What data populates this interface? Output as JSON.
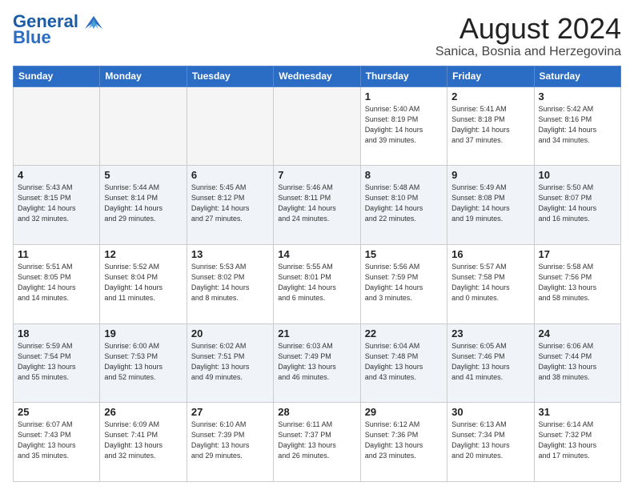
{
  "logo": {
    "line1": "General",
    "line2": "Blue"
  },
  "title": "August 2024",
  "subtitle": "Sanica, Bosnia and Herzegovina",
  "weekdays": [
    "Sunday",
    "Monday",
    "Tuesday",
    "Wednesday",
    "Thursday",
    "Friday",
    "Saturday"
  ],
  "weeks": [
    [
      {
        "day": "",
        "info": ""
      },
      {
        "day": "",
        "info": ""
      },
      {
        "day": "",
        "info": ""
      },
      {
        "day": "",
        "info": ""
      },
      {
        "day": "1",
        "info": "Sunrise: 5:40 AM\nSunset: 8:19 PM\nDaylight: 14 hours\nand 39 minutes."
      },
      {
        "day": "2",
        "info": "Sunrise: 5:41 AM\nSunset: 8:18 PM\nDaylight: 14 hours\nand 37 minutes."
      },
      {
        "day": "3",
        "info": "Sunrise: 5:42 AM\nSunset: 8:16 PM\nDaylight: 14 hours\nand 34 minutes."
      }
    ],
    [
      {
        "day": "4",
        "info": "Sunrise: 5:43 AM\nSunset: 8:15 PM\nDaylight: 14 hours\nand 32 minutes."
      },
      {
        "day": "5",
        "info": "Sunrise: 5:44 AM\nSunset: 8:14 PM\nDaylight: 14 hours\nand 29 minutes."
      },
      {
        "day": "6",
        "info": "Sunrise: 5:45 AM\nSunset: 8:12 PM\nDaylight: 14 hours\nand 27 minutes."
      },
      {
        "day": "7",
        "info": "Sunrise: 5:46 AM\nSunset: 8:11 PM\nDaylight: 14 hours\nand 24 minutes."
      },
      {
        "day": "8",
        "info": "Sunrise: 5:48 AM\nSunset: 8:10 PM\nDaylight: 14 hours\nand 22 minutes."
      },
      {
        "day": "9",
        "info": "Sunrise: 5:49 AM\nSunset: 8:08 PM\nDaylight: 14 hours\nand 19 minutes."
      },
      {
        "day": "10",
        "info": "Sunrise: 5:50 AM\nSunset: 8:07 PM\nDaylight: 14 hours\nand 16 minutes."
      }
    ],
    [
      {
        "day": "11",
        "info": "Sunrise: 5:51 AM\nSunset: 8:05 PM\nDaylight: 14 hours\nand 14 minutes."
      },
      {
        "day": "12",
        "info": "Sunrise: 5:52 AM\nSunset: 8:04 PM\nDaylight: 14 hours\nand 11 minutes."
      },
      {
        "day": "13",
        "info": "Sunrise: 5:53 AM\nSunset: 8:02 PM\nDaylight: 14 hours\nand 8 minutes."
      },
      {
        "day": "14",
        "info": "Sunrise: 5:55 AM\nSunset: 8:01 PM\nDaylight: 14 hours\nand 6 minutes."
      },
      {
        "day": "15",
        "info": "Sunrise: 5:56 AM\nSunset: 7:59 PM\nDaylight: 14 hours\nand 3 minutes."
      },
      {
        "day": "16",
        "info": "Sunrise: 5:57 AM\nSunset: 7:58 PM\nDaylight: 14 hours\nand 0 minutes."
      },
      {
        "day": "17",
        "info": "Sunrise: 5:58 AM\nSunset: 7:56 PM\nDaylight: 13 hours\nand 58 minutes."
      }
    ],
    [
      {
        "day": "18",
        "info": "Sunrise: 5:59 AM\nSunset: 7:54 PM\nDaylight: 13 hours\nand 55 minutes."
      },
      {
        "day": "19",
        "info": "Sunrise: 6:00 AM\nSunset: 7:53 PM\nDaylight: 13 hours\nand 52 minutes."
      },
      {
        "day": "20",
        "info": "Sunrise: 6:02 AM\nSunset: 7:51 PM\nDaylight: 13 hours\nand 49 minutes."
      },
      {
        "day": "21",
        "info": "Sunrise: 6:03 AM\nSunset: 7:49 PM\nDaylight: 13 hours\nand 46 minutes."
      },
      {
        "day": "22",
        "info": "Sunrise: 6:04 AM\nSunset: 7:48 PM\nDaylight: 13 hours\nand 43 minutes."
      },
      {
        "day": "23",
        "info": "Sunrise: 6:05 AM\nSunset: 7:46 PM\nDaylight: 13 hours\nand 41 minutes."
      },
      {
        "day": "24",
        "info": "Sunrise: 6:06 AM\nSunset: 7:44 PM\nDaylight: 13 hours\nand 38 minutes."
      }
    ],
    [
      {
        "day": "25",
        "info": "Sunrise: 6:07 AM\nSunset: 7:43 PM\nDaylight: 13 hours\nand 35 minutes."
      },
      {
        "day": "26",
        "info": "Sunrise: 6:09 AM\nSunset: 7:41 PM\nDaylight: 13 hours\nand 32 minutes."
      },
      {
        "day": "27",
        "info": "Sunrise: 6:10 AM\nSunset: 7:39 PM\nDaylight: 13 hours\nand 29 minutes."
      },
      {
        "day": "28",
        "info": "Sunrise: 6:11 AM\nSunset: 7:37 PM\nDaylight: 13 hours\nand 26 minutes."
      },
      {
        "day": "29",
        "info": "Sunrise: 6:12 AM\nSunset: 7:36 PM\nDaylight: 13 hours\nand 23 minutes."
      },
      {
        "day": "30",
        "info": "Sunrise: 6:13 AM\nSunset: 7:34 PM\nDaylight: 13 hours\nand 20 minutes."
      },
      {
        "day": "31",
        "info": "Sunrise: 6:14 AM\nSunset: 7:32 PM\nDaylight: 13 hours\nand 17 minutes."
      }
    ]
  ]
}
